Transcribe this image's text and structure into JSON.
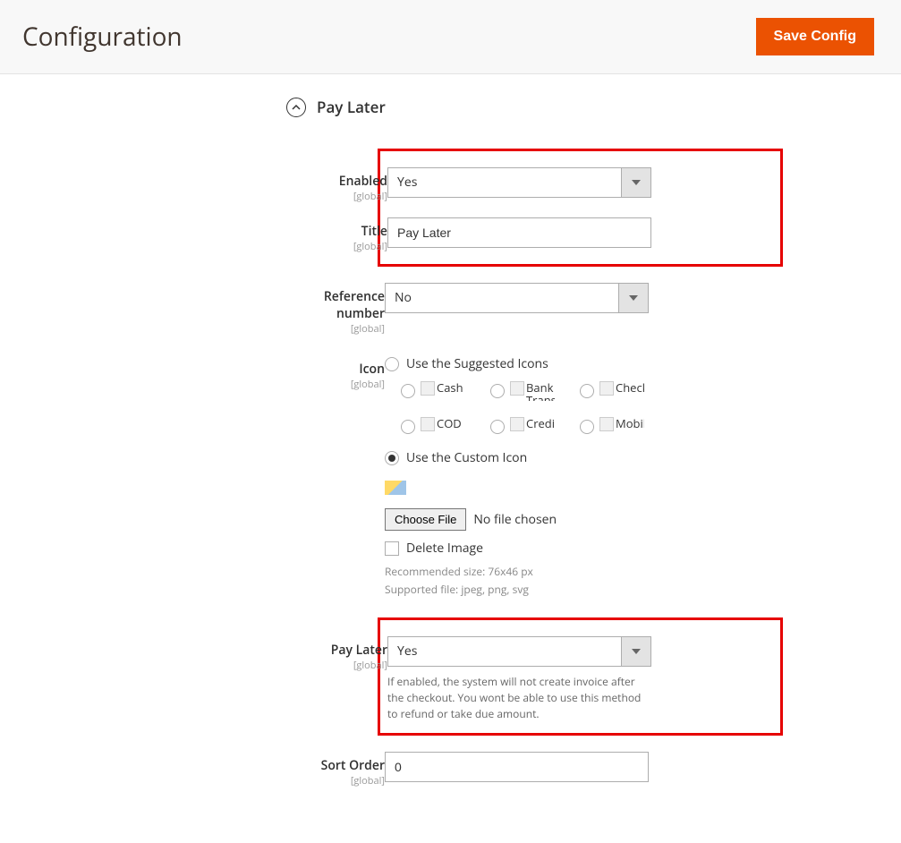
{
  "header": {
    "title": "Configuration",
    "save_label": "Save Config"
  },
  "section": {
    "title": "Pay Later"
  },
  "fields": {
    "enabled": {
      "label": "Enabled",
      "scope": "[global]",
      "value": "Yes"
    },
    "title": {
      "label": "Title",
      "scope": "[global]",
      "value": "Pay Later"
    },
    "reference": {
      "label": "Reference number",
      "scope": "[global]",
      "value": "No"
    },
    "icon": {
      "label": "Icon",
      "scope": "[global]",
      "suggested_label": "Use the Suggested Icons",
      "custom_label": "Use the Custom Icon",
      "options": [
        "Cash",
        "Bank Transfer",
        "Check",
        "COD",
        "Credit",
        "Mobile"
      ],
      "choose_file": "Choose File",
      "file_status": "No file chosen",
      "delete_label": "Delete Image",
      "hint_size": "Recommended size: 76x46 px",
      "hint_type": "Supported file: jpeg, png, svg"
    },
    "paylater": {
      "label": "Pay Later",
      "scope": "[global]",
      "value": "Yes",
      "note": "If enabled, the system will not create invoice after the checkout. You wont be able to use this method to refund or take due amount."
    },
    "sort": {
      "label": "Sort Order",
      "scope": "[global]",
      "value": "0"
    }
  }
}
